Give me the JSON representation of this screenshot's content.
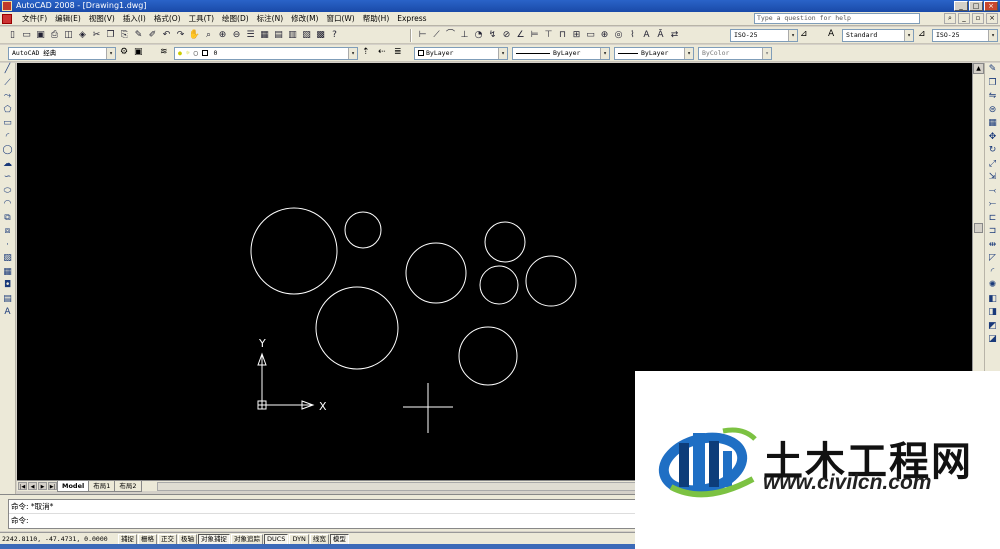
{
  "window": {
    "title": "AutoCAD 2008 - [Drawing1.dwg]",
    "controls": [
      "_",
      "□",
      "×"
    ]
  },
  "menubar": {
    "items": [
      "文件(F)",
      "编辑(E)",
      "视图(V)",
      "插入(I)",
      "格式(O)",
      "工具(T)",
      "绘图(D)",
      "标注(N)",
      "修改(M)",
      "窗口(W)",
      "帮助(H)",
      "Express"
    ],
    "help_placeholder": "Type a question for help"
  },
  "toolbar1": {
    "dimstyle": "ISO-25",
    "textstyle": "Standard",
    "tablestyle": "ISO-25"
  },
  "toolbar2": {
    "workspace": "AutoCAD 经典",
    "layer": "0",
    "color": "ByLayer",
    "linetype": "ByLayer",
    "lineweight": "ByLayer",
    "plotstyle": "ByColor"
  },
  "drawing": {
    "ucs_x_label": "X",
    "ucs_y_label": "Y"
  },
  "layout_tabs": [
    "Model",
    "布局1",
    "布局2"
  ],
  "command": {
    "history": "命令: *取消*",
    "prompt": "命令:"
  },
  "status": {
    "coordinates": "2242.8110, -47.4731, 0.0000",
    "toggles": [
      {
        "label": "捕捉",
        "on": false
      },
      {
        "label": "栅格",
        "on": false
      },
      {
        "label": "正交",
        "on": false
      },
      {
        "label": "极轴",
        "on": false
      },
      {
        "label": "对象捕捉",
        "on": true
      },
      {
        "label": "对象追踪",
        "on": false
      },
      {
        "label": "DUCS",
        "on": true
      },
      {
        "label": "DYN",
        "on": false
      },
      {
        "label": "线宽",
        "on": false
      },
      {
        "label": "模型",
        "on": true
      }
    ]
  },
  "watermark": {
    "name": "土木工程网",
    "url": "www.civilcn.com",
    "colors": {
      "blue": "#1f6fc4",
      "dark": "#0d3d7a",
      "green": "#7cc242"
    }
  }
}
